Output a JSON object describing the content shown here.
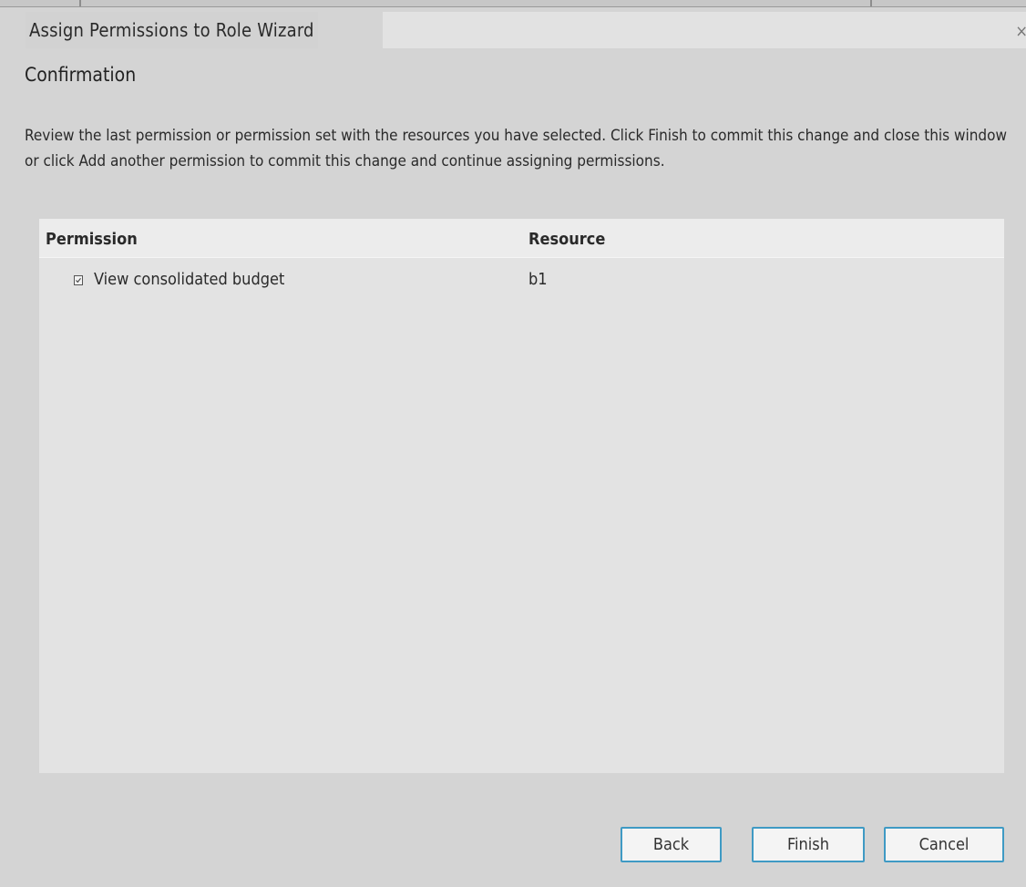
{
  "window": {
    "title": "Assign Permissions to Role Wizard",
    "close_glyph": "×"
  },
  "step": {
    "title": "Confirmation",
    "description": "Review the last permission or permission set with the resources you have selected. Click Finish to commit this change and close this window or click Add another permission to commit this change and continue assigning permissions."
  },
  "table": {
    "columns": [
      "Permission",
      "Resource"
    ],
    "rows": [
      {
        "permission": "View consolidated budget",
        "resource": "b1",
        "icon": "permission-doc-icon"
      }
    ]
  },
  "buttons": {
    "back": "Back",
    "finish": "Finish",
    "cancel": "Cancel"
  },
  "colors": {
    "button_border": "#3f9ac4",
    "background": "#d4d4d4",
    "grid_background": "#e3e3e3"
  }
}
